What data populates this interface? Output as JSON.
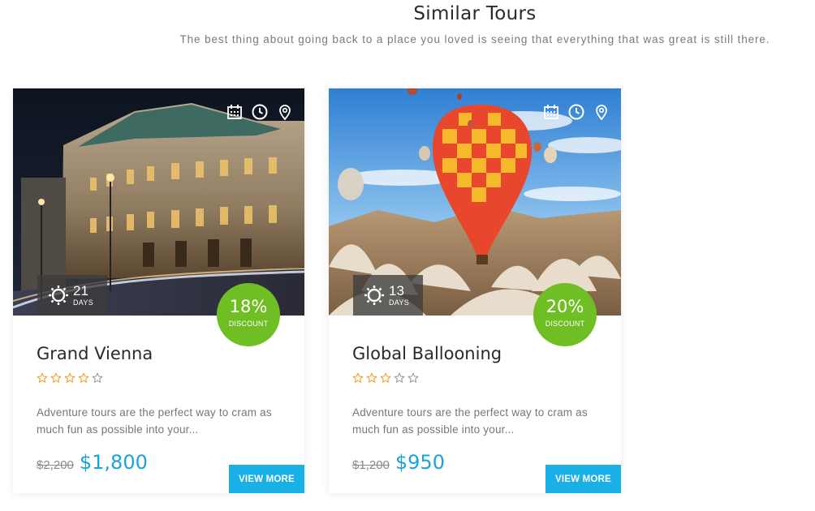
{
  "section": {
    "title": "Similar Tours",
    "subtitle": "The best thing about going back to a place you loved is seeing that everything that was great is still there."
  },
  "icons": {
    "calendar": "calendar-icon",
    "clock": "clock-icon",
    "location": "location-pin-icon",
    "sun": "sun-icon",
    "star": "star-icon"
  },
  "colors": {
    "accent": "#19b0e8",
    "price": "#1aa3d8",
    "discount": "#6fbe23",
    "star": "#f0a030"
  },
  "tours": [
    {
      "title": "Grand Vienna",
      "rating": 4,
      "rating_max": 5,
      "days_num": "21",
      "days_label": "DAYS",
      "discount_value": "18%",
      "discount_label": "DISCOUNT",
      "description": "Adventure tours are the perfect way to cram as much fun as possible into your...",
      "old_price": "$2,200",
      "new_price": "$1,800",
      "button_label": "VIEW MORE"
    },
    {
      "title": "Global Ballooning",
      "rating": 3,
      "rating_max": 5,
      "days_num": "13",
      "days_label": "DAYS",
      "discount_value": "20%",
      "discount_label": "DISCOUNT",
      "description": "Adventure tours are the perfect way to cram as much fun as possible into your...",
      "old_price": "$1,200",
      "new_price": "$950",
      "button_label": "VIEW MORE"
    }
  ]
}
